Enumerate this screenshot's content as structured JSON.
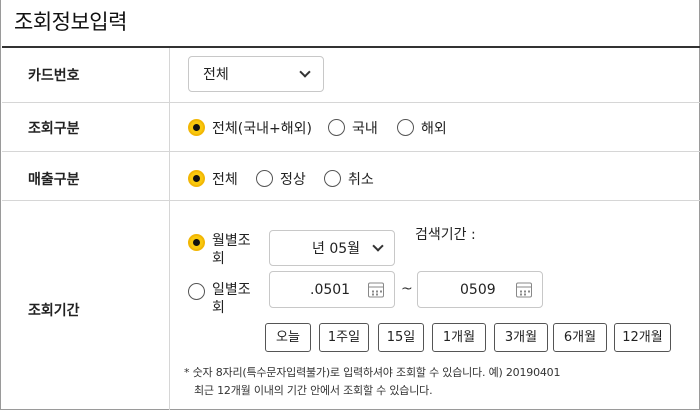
{
  "page": {
    "title": "조회정보입력"
  },
  "rows": {
    "card": {
      "label": "카드번호",
      "select_value": "전체"
    },
    "region": {
      "label": "조회구분",
      "options": [
        {
          "label": "전체(국내+해외)",
          "selected": true
        },
        {
          "label": "국내",
          "selected": false
        },
        {
          "label": "해외",
          "selected": false
        }
      ]
    },
    "sales": {
      "label": "매출구분",
      "options": [
        {
          "label": "전체",
          "selected": true
        },
        {
          "label": "정상",
          "selected": false
        },
        {
          "label": "취소",
          "selected": false
        }
      ]
    },
    "period": {
      "label": "조회기간",
      "monthly": {
        "label": "월별조회",
        "selected": true,
        "select_value": "년 05월"
      },
      "daily": {
        "label": "일별조회",
        "selected": false,
        "start_value": ".0501",
        "end_value": "0509"
      },
      "range_separator": "~",
      "search_period_label": "검색기간 :",
      "quick_buttons": [
        "오늘",
        "1주일",
        "15일",
        "1개월",
        "3개월",
        "6개월",
        "12개월"
      ],
      "notes": [
        "* 숫자 8자리(특수문자입력불가)로 입력하셔야 조회할 수 있습니다. 예) 20190401",
        "최근 12개월 이내의 기간 안에서 조회할 수 있습니다."
      ]
    }
  },
  "colors": {
    "radio_selected": "#f9c80e",
    "border": "#c8c8c8",
    "divider": "#d6d6d6",
    "header_rule": "#333333"
  },
  "icons": {
    "dropdown": "chevron-down-icon",
    "calendar": "calendar-icon"
  }
}
